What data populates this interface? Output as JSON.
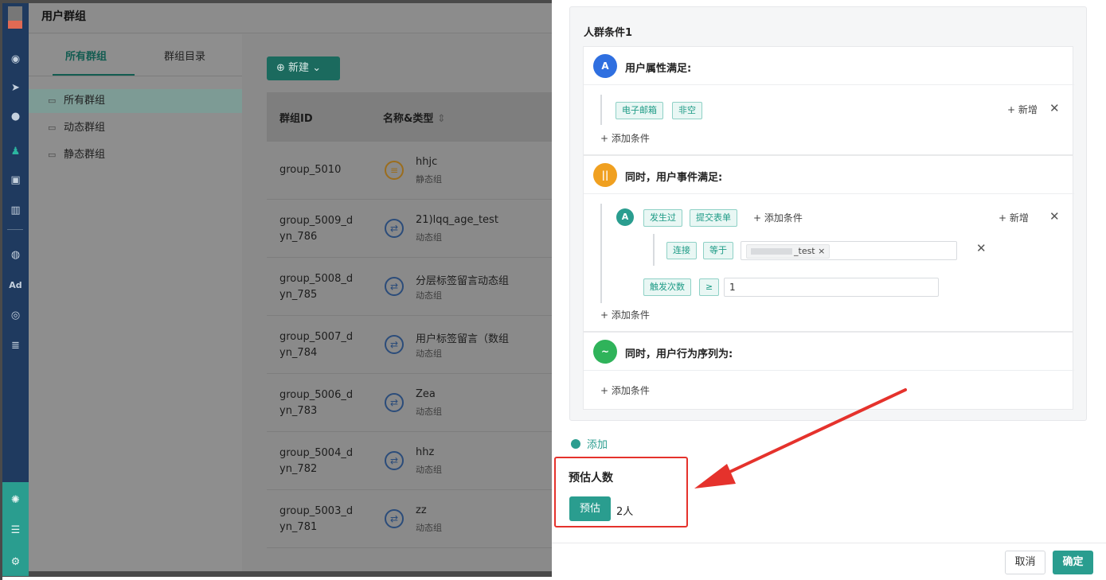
{
  "sidebar": {
    "icons": [
      "dashboard-icon",
      "send-icon",
      "user-icon",
      "user-group-icon",
      "bookmark-icon",
      "bar-chart-icon",
      "wechat-icon",
      "ad-icon",
      "target-icon",
      "list-icon",
      "radar-icon",
      "server-icon",
      "settings-icon"
    ],
    "ad_label": "Ad"
  },
  "page": {
    "title": "用户群组",
    "tabs": [
      "所有群组",
      "群组目录"
    ],
    "tree": [
      "所有群组",
      "动态群组",
      "静态群组"
    ],
    "new_button": "新建",
    "table": {
      "headers": [
        "群组ID",
        "名称&类型"
      ],
      "rows": [
        {
          "id": "group_5010",
          "name": "hhjc",
          "type": "静态组",
          "kind": "static"
        },
        {
          "id": "group_5009_d\nyn_786",
          "name": "21)lqq_age_test",
          "type": "动态组",
          "kind": "dynamic"
        },
        {
          "id": "group_5008_d\nyn_785",
          "name": "分层标签留言动态组",
          "type": "动态组",
          "kind": "dynamic"
        },
        {
          "id": "group_5007_d\nyn_784",
          "name": "用户标签留言（数组",
          "type": "动态组",
          "kind": "dynamic"
        },
        {
          "id": "group_5006_d\nyn_783",
          "name": "Zea",
          "type": "动态组",
          "kind": "dynamic"
        },
        {
          "id": "group_5004_d\nyn_782",
          "name": "hhz",
          "type": "动态组",
          "kind": "dynamic"
        },
        {
          "id": "group_5003_d\nyn_781",
          "name": "zz",
          "type": "动态组",
          "kind": "dynamic"
        }
      ]
    }
  },
  "drawer": {
    "card_title": "人群条件1",
    "block1": {
      "label": "用户属性满足:",
      "icon_text": "A",
      "tags": [
        "电子邮箱",
        "非空"
      ],
      "add_new": "+ 新增",
      "add_condition": "+ 添加条件"
    },
    "block2": {
      "label": "同时，用户事件满足:",
      "icon_text": "||",
      "event_letter": "A",
      "event_tags": [
        "发生过",
        "提交表单"
      ],
      "inline_add": "+ 添加条件",
      "add_new": "+ 新增",
      "filter_tags": [
        "连接",
        "等于"
      ],
      "filter_value": "_test",
      "count_tags": [
        "触发次数",
        "≥"
      ],
      "count_value": "1",
      "add_condition": "+ 添加条件"
    },
    "block3": {
      "label": "同时，用户行为序列为:",
      "icon_text": "~",
      "add_condition": "+ 添加条件"
    },
    "add_link": "添加",
    "estimate": {
      "title": "预估人数",
      "button": "预估",
      "count": "2人"
    },
    "cancel": "取消",
    "confirm": "确定"
  },
  "colors": {
    "accent": "#2a9d8f",
    "highlight": "#e5322c",
    "block1_icon": "#2f6fe0",
    "block2_icon": "#f0a020",
    "block3_icon": "#2fb35a"
  }
}
